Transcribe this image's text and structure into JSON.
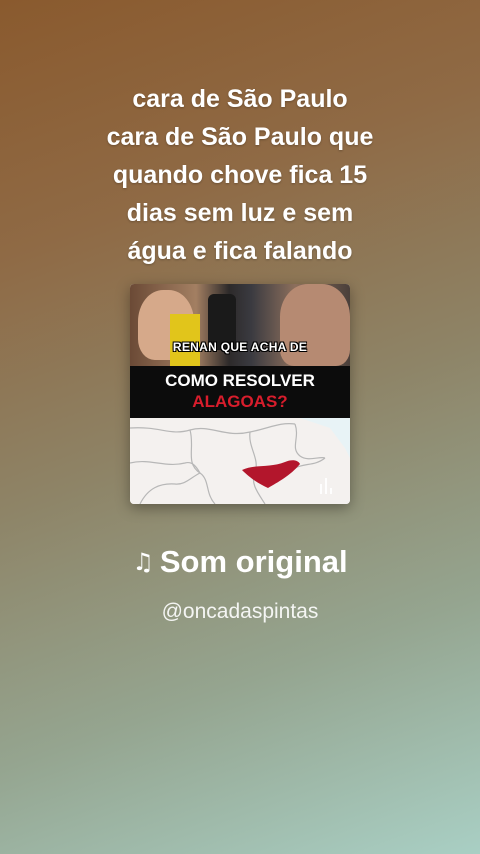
{
  "lyrics": {
    "lines": [
      "cara de São Paulo",
      "cara de São Paulo que",
      "quando chove fica 15",
      "dias sem luz e sem",
      "água e fica falando"
    ]
  },
  "cover": {
    "caption": "RENAN QUE ACHA DE",
    "headline_line1": "COMO RESOLVER",
    "headline_line2": "ALAGOAS?",
    "overlay_icon": "waveform-icon"
  },
  "audio": {
    "icon": "music-note-icon",
    "title": "Som original",
    "handle": "@oncadaspintas"
  },
  "colors": {
    "headline_red": "#d81d2c",
    "highlight_region": "#b3162c"
  }
}
